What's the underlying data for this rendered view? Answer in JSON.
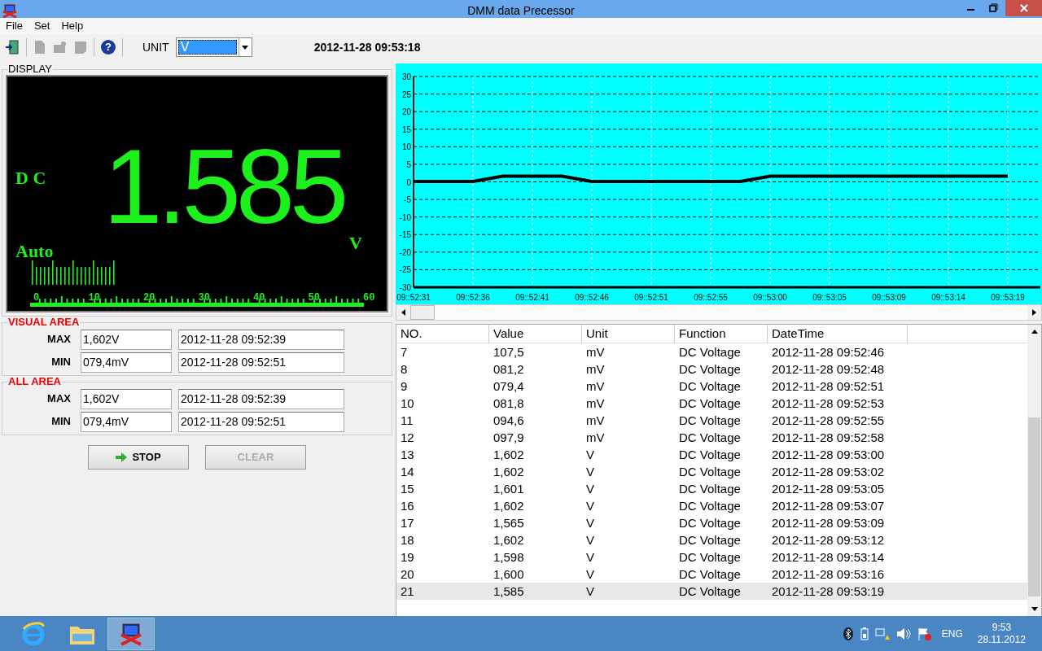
{
  "window": {
    "title": "DMM data Precessor"
  },
  "menu": [
    {
      "label": "File"
    },
    {
      "label": "Set"
    },
    {
      "label": "Help"
    }
  ],
  "toolbar": [
    {
      "kind": "exit",
      "disabled": false
    },
    {
      "kind": "new",
      "disabled": true
    },
    {
      "kind": "open",
      "disabled": true
    },
    {
      "kind": "save",
      "disabled": true
    },
    {
      "kind": "help",
      "disabled": false,
      "glyph": "?"
    }
  ],
  "unit": {
    "label": "UNIT",
    "value": "V"
  },
  "timestamp": "2012-11-28 09:53:18",
  "display": {
    "title": "DISPLAY",
    "mode": "D C",
    "range": "Auto",
    "reading": "1.585",
    "unit": "V",
    "scale_labels": [
      "0",
      "10",
      "20",
      "30",
      "40",
      "50",
      "60"
    ]
  },
  "visual_area": {
    "title": "VISUAL AREA",
    "rows": [
      {
        "label": "MAX",
        "value": "1,602V",
        "time": "2012-11-28 09:52:39"
      },
      {
        "label": "MIN",
        "value": "079,4mV",
        "time": "2012-11-28 09:52:51"
      }
    ]
  },
  "all_area": {
    "title": "ALL AREA",
    "rows": [
      {
        "label": "MAX",
        "value": "1,602V",
        "time": "2012-11-28 09:52:39"
      },
      {
        "label": "MIN",
        "value": "079,4mV",
        "time": "2012-11-28 09:52:51"
      }
    ]
  },
  "buttons": [
    {
      "label": "STOP",
      "kind": "stop",
      "disabled": false
    },
    {
      "label": "CLEAR",
      "kind": "clear",
      "disabled": true
    }
  ],
  "chart": {
    "chart_data": {
      "type": "line",
      "categories": [
        "09::52:31",
        null,
        "09::52:36",
        null,
        "09::52:41",
        null,
        "09::52:46",
        null,
        "09::52:51",
        null,
        "09::52:55",
        null,
        "09::53:00",
        null,
        "09::53:05",
        null,
        "09::53:09",
        null,
        "09::53:14",
        null,
        "09::53:19"
      ],
      "series": [
        {
          "color": "#000000",
          "values": [
            0.1,
            0.1,
            0.1,
            1.6,
            1.6,
            1.6,
            0.1,
            0.1,
            0.1,
            0.1,
            0.1,
            0.1,
            1.6,
            1.6,
            1.6,
            1.6,
            1.6,
            1.6,
            1.6,
            1.6,
            1.6
          ]
        }
      ],
      "grid": true,
      "ylim": [
        -30,
        30
      ],
      "yticks": [
        -30,
        -25,
        -20,
        -15,
        -10,
        -5,
        0,
        5,
        10,
        15,
        20,
        25,
        30
      ]
    }
  },
  "table": {
    "columns": [
      "NO.",
      "Value",
      "Unit",
      "Function",
      "DateTime"
    ],
    "rows": [
      {
        "cells": [
          "7",
          "107,5",
          "mV",
          "DC Voltage",
          "2012-11-28 09:52:46"
        ],
        "selected": false
      },
      {
        "cells": [
          "8",
          "081,2",
          "mV",
          "DC Voltage",
          "2012-11-28 09:52:48"
        ],
        "selected": false
      },
      {
        "cells": [
          "9",
          "079,4",
          "mV",
          "DC Voltage",
          "2012-11-28 09:52:51"
        ],
        "selected": false
      },
      {
        "cells": [
          "10",
          "081,8",
          "mV",
          "DC Voltage",
          "2012-11-28 09:52:53"
        ],
        "selected": false
      },
      {
        "cells": [
          "11",
          "094,6",
          "mV",
          "DC Voltage",
          "2012-11-28 09:52:55"
        ],
        "selected": false
      },
      {
        "cells": [
          "12",
          "097,9",
          "mV",
          "DC Voltage",
          "2012-11-28 09:52:58"
        ],
        "selected": false
      },
      {
        "cells": [
          "13",
          "1,602",
          "V",
          "DC Voltage",
          "2012-11-28 09:53:00"
        ],
        "selected": false
      },
      {
        "cells": [
          "14",
          "1,602",
          "V",
          "DC Voltage",
          "2012-11-28 09:53:02"
        ],
        "selected": false
      },
      {
        "cells": [
          "15",
          "1,601",
          "V",
          "DC Voltage",
          "2012-11-28 09:53:05"
        ],
        "selected": false
      },
      {
        "cells": [
          "16",
          "1,602",
          "V",
          "DC Voltage",
          "2012-11-28 09:53:07"
        ],
        "selected": false
      },
      {
        "cells": [
          "17",
          "1,565",
          "V",
          "DC Voltage",
          "2012-11-28 09:53:09"
        ],
        "selected": false
      },
      {
        "cells": [
          "18",
          "1,602",
          "V",
          "DC Voltage",
          "2012-11-28 09:53:12"
        ],
        "selected": false
      },
      {
        "cells": [
          "19",
          "1,598",
          "V",
          "DC Voltage",
          "2012-11-28 09:53:14"
        ],
        "selected": false
      },
      {
        "cells": [
          "20",
          "1,600",
          "V",
          "DC Voltage",
          "2012-11-28 09:53:16"
        ],
        "selected": false
      },
      {
        "cells": [
          "21",
          "1,585",
          "V",
          "DC Voltage",
          "2012-11-28 09:53:19"
        ],
        "selected": true
      }
    ]
  },
  "taskbar": {
    "apps": [
      {
        "kind": "browser",
        "active": false
      },
      {
        "kind": "folder",
        "active": false
      },
      {
        "kind": "dmm",
        "active": true
      }
    ],
    "language": "ENG",
    "time": "9:53",
    "date": "28.11.2012"
  }
}
